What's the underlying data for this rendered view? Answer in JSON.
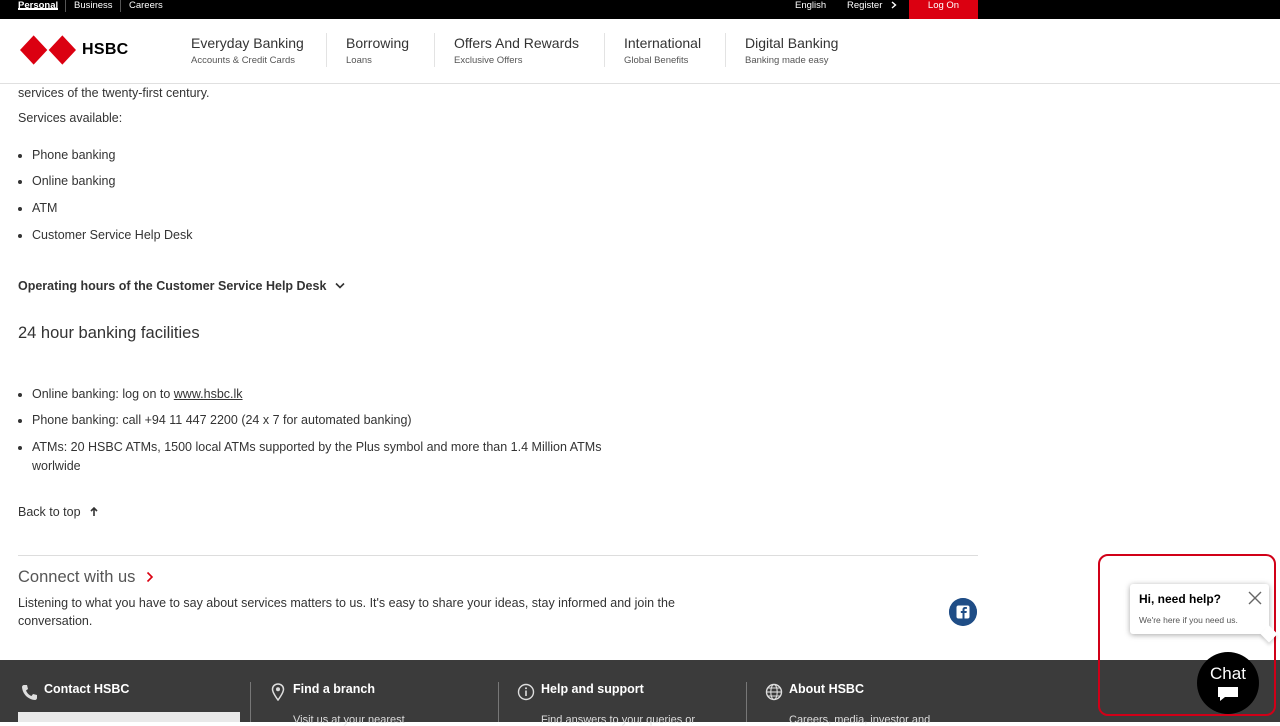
{
  "topbar": {
    "segments": [
      "Personal",
      "Business",
      "Careers"
    ],
    "language": "English",
    "register": "Register",
    "logon": "Log On"
  },
  "header": {
    "brand": "HSBC",
    "nav": [
      {
        "title": "Everyday Banking",
        "sub": "Accounts & Credit Cards"
      },
      {
        "title": "Borrowing",
        "sub": "Loans"
      },
      {
        "title": "Offers And Rewards",
        "sub": "Exclusive Offers"
      },
      {
        "title": "International",
        "sub": "Global Benefits"
      },
      {
        "title": "Digital Banking",
        "sub": "Banking made easy"
      }
    ]
  },
  "content": {
    "intro_tail": "services of the twenty-first century.",
    "services_label": "Services available:",
    "services": [
      "Phone banking",
      "Online banking",
      "ATM",
      "Customer Service Help Desk"
    ],
    "hours_toggle": "Operating hours of the Customer Service Help Desk",
    "facilities_heading": "24 hour banking facilities",
    "facilities": {
      "online_prefix": "Online banking: log on to ",
      "online_link": "www.hsbc.lk",
      "phone": "Phone banking: call +94 11 447 2200 (24 x 7 for automated banking)",
      "atm_line1": "ATMs: 20 HSBC ATMs, 1500 local ATMs supported by the Plus symbol and more than 1.4 Million ATMs",
      "atm_line2": "worlwide"
    },
    "back_to_top": "Back to top",
    "connect_heading": "Connect with us",
    "connect_line1": "Listening to what you have to say about services matters to us. It's easy to share your ideas, stay informed and join the",
    "connect_line2": "conversation."
  },
  "footer": [
    {
      "title": "Contact HSBC",
      "sub": ""
    },
    {
      "title": "Find a branch",
      "sub": "Visit us at your nearest"
    },
    {
      "title": "Help and support",
      "sub": "Find answers to your queries or"
    },
    {
      "title": "About HSBC",
      "sub": "Careers, media, investor and"
    }
  ],
  "chat": {
    "title": "Hi, need help?",
    "subtitle": "We're here if you need us.",
    "button": "Chat"
  },
  "colors": {
    "brand_red": "#db0011",
    "footer_bg": "#3b3b3b",
    "facebook": "#1f4d86"
  }
}
